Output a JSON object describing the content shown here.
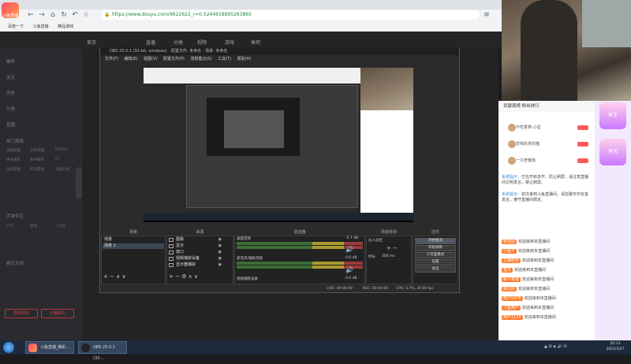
{
  "browser": {
    "url": "https://www.douyu.com/9622622_r=0.5244918895263865",
    "bookmarks": [
      "百度一下",
      "斗鱼直播",
      "精品游戏"
    ],
    "logo_text": "斗鱼直播"
  },
  "douyu": {
    "nav": [
      "首页",
      "直播",
      "分类",
      "视频",
      "游戏",
      "鱼吧"
    ],
    "sidebar": [
      {
        "label": "推荐"
      },
      {
        "label": "关注"
      },
      {
        "label": "历史"
      },
      {
        "label": "分类"
      },
      {
        "label": "直播"
      }
    ],
    "sidebar_grid": [
      [
        "英雄联盟",
        "王者荣耀",
        "DOTA2"
      ],
      [
        "绝地求生",
        "和平精英",
        "CF"
      ],
      [
        "主机游戏",
        "怀旧游戏",
        "穿越火线"
      ],
      [
        "户外",
        "颜值",
        "二次元"
      ]
    ],
    "sections": [
      "热门游戏",
      "手游专区",
      "娱乐天地"
    ],
    "buttons": [
      "签到领奖",
      "开播有礼"
    ]
  },
  "chat": {
    "header": "贡献周榜  粉丝排行",
    "ranks": [
      {
        "name": "不吃香菜-小星"
      },
      {
        "name": "爱喝奶茶的猫"
      },
      {
        "name": "一只老番茄"
      }
    ],
    "messages": [
      {
        "user": "系统提示：",
        "text": "已在开启多开、防止刷屏、请注意直播间文明发言，禁止刷屏。"
      },
      {
        "user": "系统提示：",
        "text": "初次来到斗鱼直播间，请在聊天中友善发言，遵守直播间规定。"
      },
      {
        "user": "粉丝团",
        "text": "欢迎来到本直播间"
      },
      {
        "user": "小鱼干",
        "text": "欢迎来到本直播间"
      },
      {
        "user": "主播粉丝",
        "text": "欢迎来到本直播间"
      },
      {
        "user": "鱼丸",
        "text": "欢迎来到本直播间"
      },
      {
        "user": "新人报道",
        "text": "欢迎来到本直播间"
      },
      {
        "user": "路过的",
        "text": "欢迎来到本直播间"
      },
      {
        "user": "用户5478",
        "text": "欢迎来到本直播间"
      },
      {
        "user": "斗鱼用户",
        "text": "欢迎来到本直播间"
      },
      {
        "user": "用户1125",
        "text": "欢迎来到本直播间"
      }
    ],
    "gifts": [
      "鱼宝",
      "鱼宝"
    ]
  },
  "obs": {
    "title": "OBS 25.0.1 (32-bit, windows) - 配置文件: 未命名 - 场景: 未命名",
    "menu": [
      "文件(F)",
      "编辑(E)",
      "视图(V)",
      "配置文件(P)",
      "场景集合(S)",
      "工具(T)",
      "帮助(H)"
    ],
    "panels": {
      "scenes": "场景",
      "sources": "来源",
      "mixer": "混音器",
      "transitions": "场景转场",
      "controls": "控件"
    },
    "scenes": [
      {
        "name": "场景",
        "selected": false
      },
      {
        "name": "场景 2",
        "selected": true
      }
    ],
    "sources": [
      "图像",
      "显示",
      "窗口",
      "视频捕获设备",
      "显示器捕获"
    ],
    "mixer": [
      {
        "label": "桌面音频",
        "db": "-5.7 dB",
        "level": 0.6
      },
      {
        "label": "麦克风/辅助音频",
        "db": "0.0 dB",
        "level": 0.5
      },
      {
        "label": "视频捕获设备",
        "db": "0.0 dB",
        "level": 0.2
      }
    ],
    "transition": {
      "type": "淡入淡出",
      "duration_label": "时长",
      "duration": "300 ms"
    },
    "controls": [
      {
        "label": "开始推流",
        "active": true
      },
      {
        "label": "开始录制",
        "active": false
      },
      {
        "label": "工作室模式",
        "active": false
      },
      {
        "label": "设置",
        "active": false
      },
      {
        "label": "退出",
        "active": false
      }
    ],
    "status": {
      "live": "LIVE: 00:00:00",
      "rec": "REC: 00:00:00",
      "cpu": "CPU: 3.7%, 30.00 fps"
    }
  },
  "taskbar": {
    "items": [
      {
        "label": "斗鱼直播_精彩..."
      },
      {
        "label": "OBS 25.0.1 (32-..."
      }
    ],
    "time": "20:13",
    "date": "2022/3/27"
  }
}
